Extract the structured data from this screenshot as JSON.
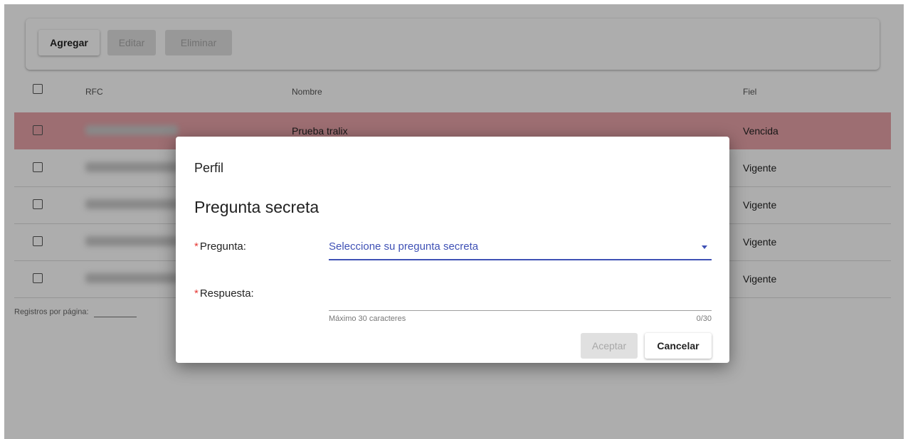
{
  "toolbar": {
    "add_label": "Agregar",
    "edit_label": "Editar",
    "delete_label": "Eliminar"
  },
  "table": {
    "columns": [
      "RFC",
      "Nombre",
      "Fiel"
    ],
    "rows": [
      {
        "nombre": "Prueba tralix",
        "fiel": "Vencida",
        "status": "expired"
      },
      {
        "nombre": "",
        "fiel": "Vigente",
        "status": "valid"
      },
      {
        "nombre": "",
        "fiel": "Vigente",
        "status": "valid"
      },
      {
        "nombre": "",
        "fiel": "Vigente",
        "status": "valid"
      },
      {
        "nombre": "",
        "fiel": "Vigente",
        "status": "valid"
      }
    ],
    "rows_per_page_label": "Registros por página:"
  },
  "dialog": {
    "title": "Perfil",
    "heading": "Pregunta secreta",
    "question_label": "Pregunta:",
    "question_placeholder": "Seleccione su pregunta secreta",
    "answer_label": "Respuesta:",
    "answer_value": "",
    "answer_hint": "Máximo 30 caracteres",
    "answer_counter": "0/30",
    "accept_label": "Aceptar",
    "cancel_label": "Cancelar"
  },
  "colors": {
    "expired_row": "#e8a2a8",
    "accent": "#3f51b5",
    "required": "#e53935"
  }
}
